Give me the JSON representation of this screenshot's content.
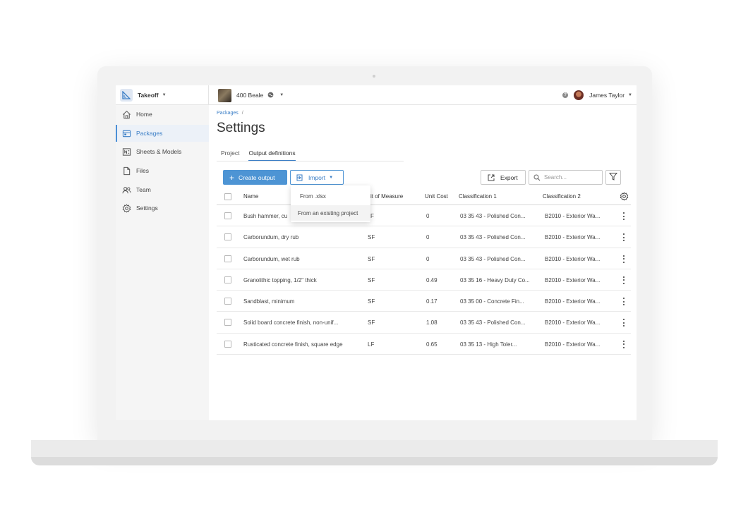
{
  "topbar": {
    "app_name": "Takeoff",
    "project_name": "400 Beale",
    "user_name": "James Taylor"
  },
  "sidebar": {
    "items": [
      {
        "label": "Home",
        "icon": "home-icon"
      },
      {
        "label": "Packages",
        "icon": "packages-icon",
        "active": true
      },
      {
        "label": "Sheets & Models",
        "icon": "sheets-icon"
      },
      {
        "label": "Files",
        "icon": "file-icon"
      },
      {
        "label": "Team",
        "icon": "team-icon"
      },
      {
        "label": "Settings",
        "icon": "gear-icon"
      }
    ]
  },
  "breadcrumb": {
    "parent": "Packages",
    "separator": "/"
  },
  "page": {
    "title": "Settings"
  },
  "tabs": [
    {
      "label": "Project",
      "active": false
    },
    {
      "label": "Output definitions",
      "active": true
    }
  ],
  "toolbar": {
    "create_label": "Create output",
    "import_label": "Import",
    "export_label": "Export",
    "search_placeholder": "Search..."
  },
  "import_menu": {
    "items": [
      "From .xlsx",
      "From an existing project"
    ]
  },
  "table": {
    "columns": [
      "Name",
      "it of Measure",
      "Unit Cost",
      "Classification 1",
      "Classification 2"
    ],
    "rows": [
      {
        "name": "Bush hammer, cu",
        "unit": "F",
        "cost": "0",
        "class1": "03 35 43 - Polished Con...",
        "class2": "B2010 - Exterior Wa..."
      },
      {
        "name": "Carborundum, dry rub",
        "unit": "SF",
        "cost": "0",
        "class1": "03 35 43 - Polished Con...",
        "class2": "B2010 - Exterior Wa..."
      },
      {
        "name": "Carborundum, wet rub",
        "unit": "SF",
        "cost": "0",
        "class1": "03 35 43 - Polished Con...",
        "class2": "B2010 - Exterior Wa..."
      },
      {
        "name": "Granolithic topping, 1/2\" thick",
        "unit": "SF",
        "cost": "0.49",
        "class1": "03 35 16 - Heavy Duty Co...",
        "class2": "B2010 - Exterior Wa..."
      },
      {
        "name": "Sandblast, minimum",
        "unit": "SF",
        "cost": "0.17",
        "class1": "03 35 00 - Concrete Fin...",
        "class2": "B2010 - Exterior Wa..."
      },
      {
        "name": "Solid board concrete finish, non-unif...",
        "unit": "SF",
        "cost": "1.08",
        "class1": "03 35 43 - Polished Con...",
        "class2": "B2010 - Exterior Wa..."
      },
      {
        "name": "Rusticated concrete finish, square edge",
        "unit": "LF",
        "cost": "0.65",
        "class1": "03 35 13 - High Toler...",
        "class2": "B2010 - Exterior Wa..."
      }
    ]
  },
  "colors": {
    "accent": "#4d94d4",
    "link": "#3a7ec6",
    "sidebar_bg": "#f5f5f5"
  }
}
